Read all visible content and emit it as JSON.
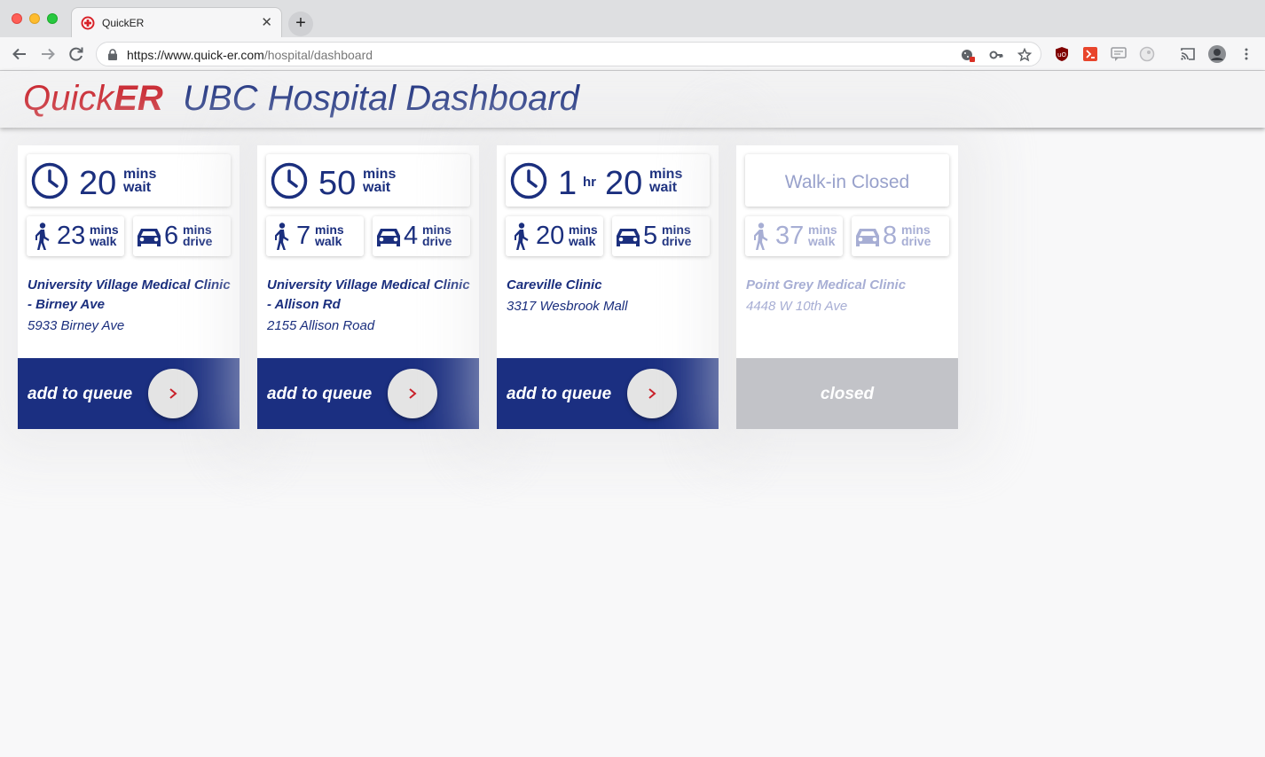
{
  "browser": {
    "tab_title": "QuickER",
    "url_host": "https://www.quick-er.com",
    "url_path": "/hospital/dashboard",
    "tab_close": "✕",
    "new_tab": "+"
  },
  "header": {
    "brand_quick": "Quick",
    "brand_er": "ER",
    "title": "UBC Hospital Dashboard"
  },
  "colors": {
    "brand_red": "#c9212a",
    "navy": "#1b2f7e",
    "closed_gray": "#c2c3c8"
  },
  "clinics": [
    {
      "wait_mins": "20",
      "wait_unit_top": "mins",
      "wait_unit_bottom": "wait",
      "walk_mins": "23",
      "drive_mins": "6",
      "name": "University Village Medical Clinic - Birney Ave",
      "address": "5933 Birney Ave",
      "action": "add to queue"
    },
    {
      "wait_mins": "50",
      "wait_unit_top": "mins",
      "wait_unit_bottom": "wait",
      "walk_mins": "7",
      "drive_mins": "4",
      "name": "University Village Medical Clinic - Allison Rd",
      "address": "2155 Allison Road",
      "action": "add to queue"
    },
    {
      "wait_hr": "1",
      "wait_hr_unit": "hr",
      "wait_mins": "20",
      "wait_unit_top": "mins",
      "wait_unit_bottom": "wait",
      "walk_mins": "20",
      "drive_mins": "5",
      "name": "Careville Clinic",
      "address": "3317 Wesbrook Mall",
      "action": "add to queue"
    },
    {
      "status": "Walk-in Closed",
      "walk_mins": "37",
      "drive_mins": "8",
      "name": "Point Grey Medical Clinic",
      "address": "4448 W 10th Ave",
      "action": "closed"
    }
  ],
  "labels": {
    "mins": "mins",
    "walk": "walk",
    "drive": "drive"
  }
}
